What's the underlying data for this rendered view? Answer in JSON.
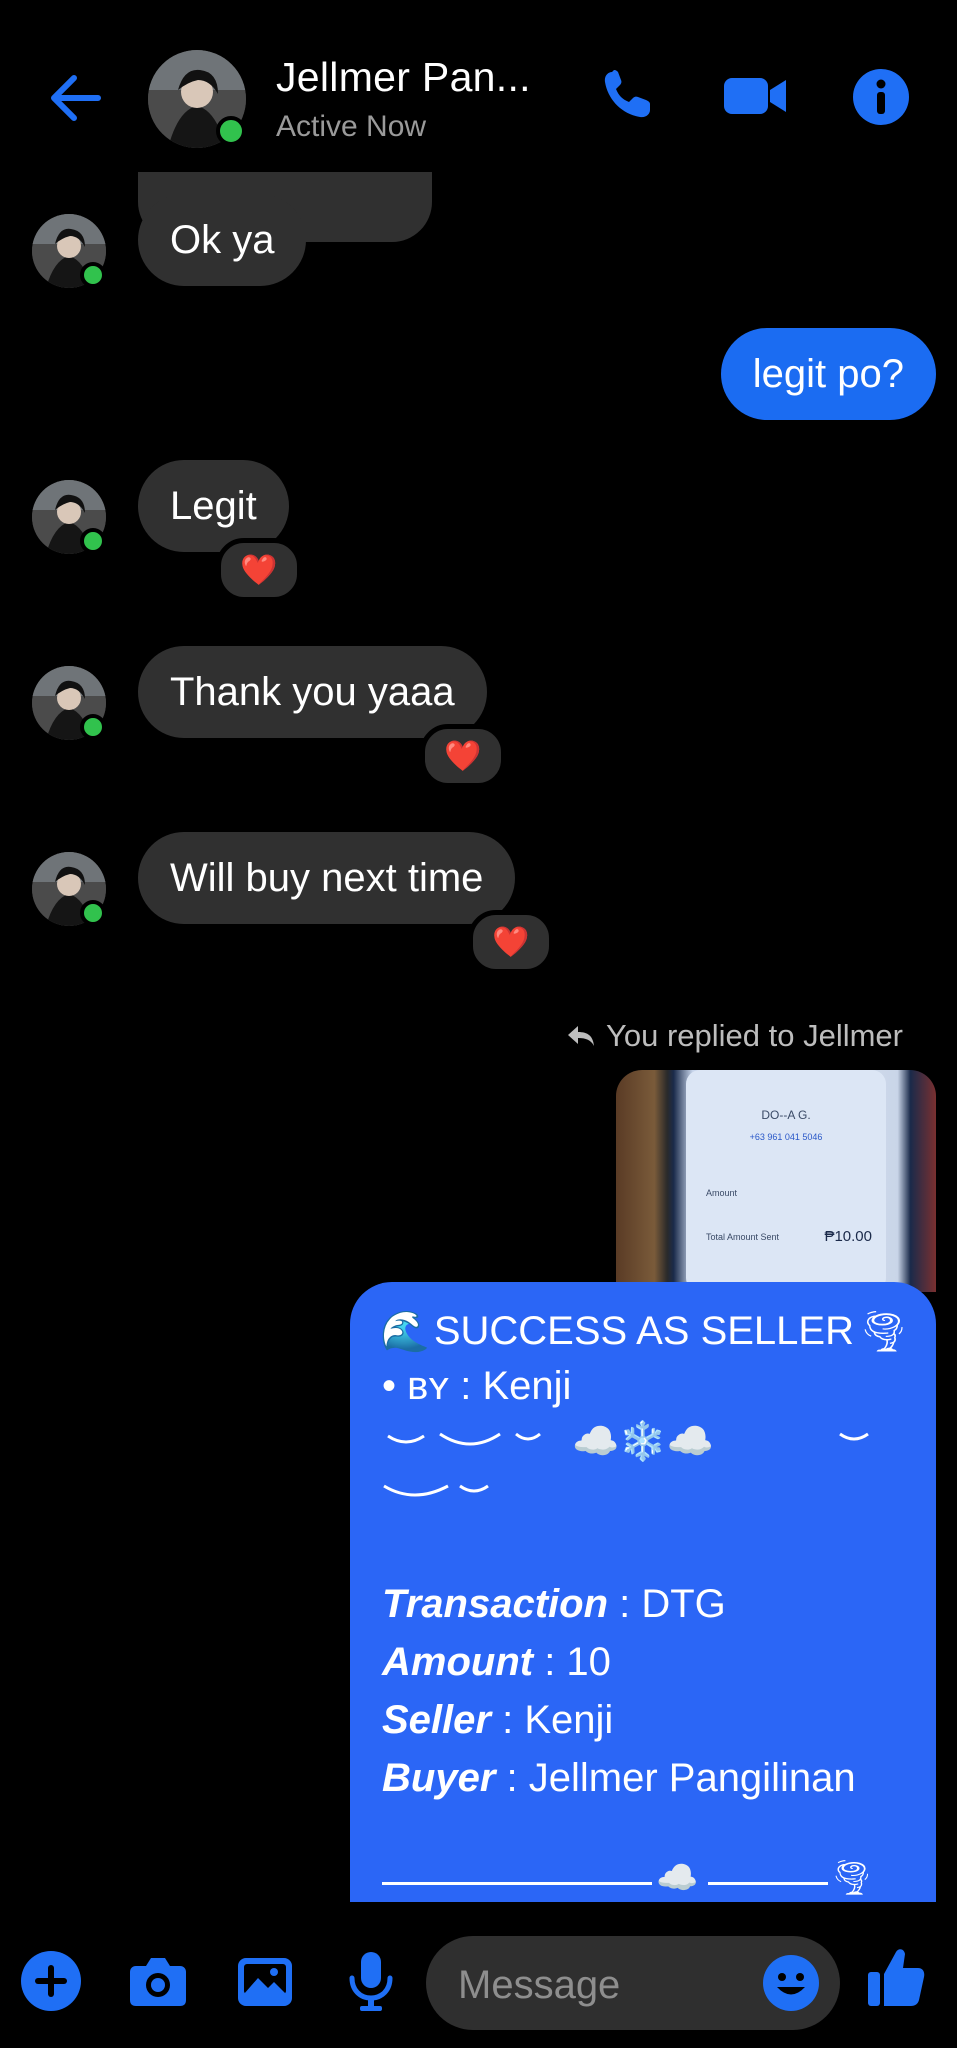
{
  "header": {
    "contact_name": "Jellmer Pan...",
    "status": "Active Now"
  },
  "messages": [
    {
      "text": "Ok ya"
    },
    {
      "text": "legit po?"
    },
    {
      "text": "Legit",
      "reaction": "❤️"
    },
    {
      "text": "Thank you yaaa",
      "reaction": "❤️"
    },
    {
      "text": "Will buy next time",
      "reaction": "❤️"
    }
  ],
  "reply_note": "You replied to Jellmer",
  "photo": {
    "recipient": "DO--A G.",
    "number": "+63 961 041 5046",
    "amount_label": "Amount",
    "total_label": "Total Amount Sent",
    "total_value": "₱10.00"
  },
  "seller_card": {
    "title": "SUCCESS AS SELLER",
    "by_line": "• ʙʏ : Kenji",
    "transaction_label": "Transaction",
    "transaction_value": ": DTG",
    "amount_label": "Amount",
    "amount_value": ": 10",
    "seller_label": "Seller",
    "seller_value": ": Kenji",
    "buyer_label": "Buyer",
    "buyer_value": ": Jellmer Pangilinan"
  },
  "composer": {
    "placeholder": "Message"
  },
  "colors": {
    "accent": "#1b6cf2",
    "card": "#2b66f6",
    "incoming": "#303030",
    "online": "#31c24d",
    "heart": "#ff2d3a"
  }
}
